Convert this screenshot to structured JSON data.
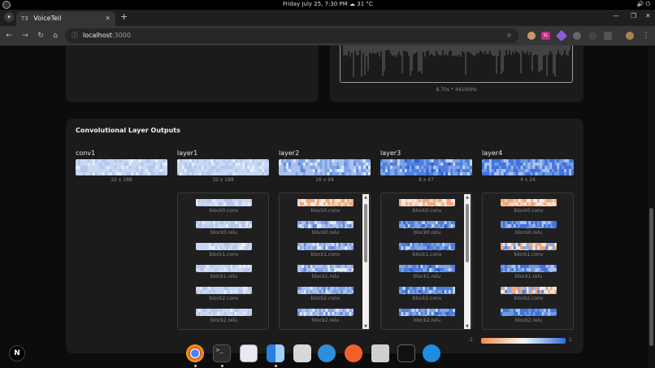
{
  "os": {
    "clock": "Friday July 25, 7:30 PM",
    "weather": "31 °C"
  },
  "browser": {
    "tab_title": "VoiceTell",
    "tab_icon": "T3",
    "url_host": "localhost",
    "url_port": ":3000"
  },
  "waveform": {
    "caption": "8.70s * 44100Hz"
  },
  "section": {
    "title": "Convolutional Layer Outputs",
    "layers": [
      {
        "name": "conv1",
        "shape": "32 x 188"
      },
      {
        "name": "layer1",
        "shape": "32 x 188"
      },
      {
        "name": "layer2",
        "shape": "16 x 94"
      },
      {
        "name": "layer3",
        "shape": "8 x 47"
      },
      {
        "name": "layer4",
        "shape": "4 x 24"
      }
    ],
    "sub_layers": {
      "layer1": [
        "block0.conv",
        "block0.relu",
        "block1.conv",
        "block1.relu",
        "block2.conv",
        "block2.relu"
      ],
      "layer2": [
        "block0.conv",
        "block0.relu",
        "block1.conv",
        "block1.relu",
        "block2.conv",
        "block2.relu"
      ],
      "layer3": [
        "block0.conv",
        "block0.relu",
        "block1.conv",
        "block1.relu",
        "block2.conv",
        "block2.relu"
      ],
      "layer4": [
        "block0.conv",
        "block0.relu",
        "block1.conv",
        "block1.relu",
        "block2.conv",
        "block2.relu"
      ]
    },
    "legend": {
      "min": "-1",
      "max": "1"
    }
  },
  "dock": {
    "badge": "N"
  },
  "colors": {
    "positive": "#2f6cdb",
    "negative": "#f4894f",
    "neutral": "#f5f5f5",
    "card": "#1b1b1b"
  }
}
